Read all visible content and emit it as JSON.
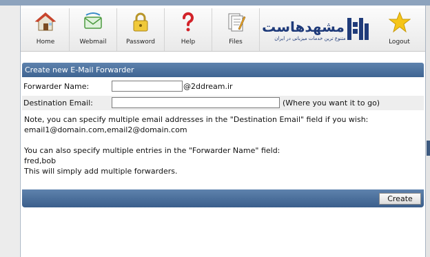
{
  "nav": {
    "home_label": "Home",
    "webmail_label": "Webmail",
    "password_label": "Password",
    "help_label": "Help",
    "files_label": "Files",
    "logout_label": "Logout"
  },
  "logo": {
    "text": "مشهدهاست",
    "tagline": "متنوع ترین خدمات میزبانی در ایران"
  },
  "form": {
    "title": "Create new E-Mail Forwarder",
    "forwarder_label": "Forwarder Name:",
    "forwarder_value": "",
    "domain_suffix": "@2ddream.ir",
    "destination_label": "Destination Email:",
    "destination_value": "",
    "destination_hint": "(Where you want it to go)",
    "note_line1": "Note, you can specify multiple email addresses in the \"Destination Email\" field if you wish:",
    "note_line2": "email1@domain.com,email2@domain.com",
    "note_line3": "You can also specify multiple entries in the \"Forwarder Name\" field:",
    "note_line4": "fred,bob",
    "note_line5": "This will simply add multiple forwarders.",
    "create_label": "Create"
  },
  "colors": {
    "header_blue": "#4a6f9c",
    "accent_star": "#f5c518"
  }
}
